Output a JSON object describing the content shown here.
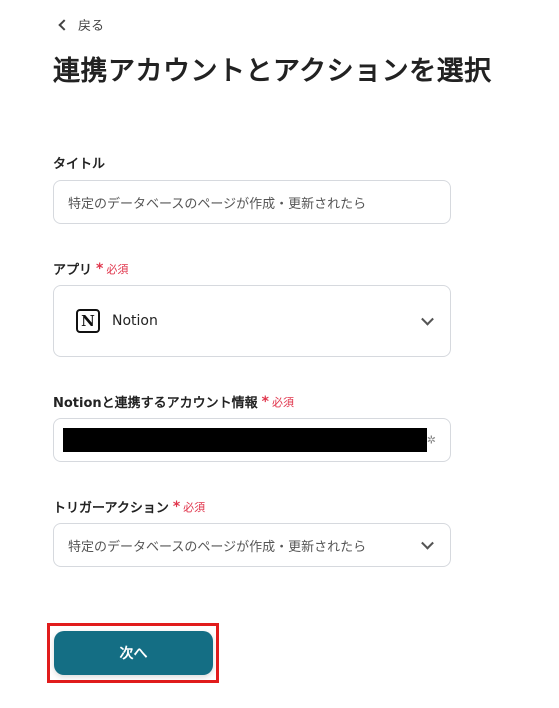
{
  "header": {
    "back_label": "戻る",
    "title": "連携アカウントとアクションを選択"
  },
  "form": {
    "title_field": {
      "label": "タイトル",
      "value": "特定のデータベースのページが作成・更新されたら"
    },
    "app_field": {
      "label": "アプリ",
      "required_label": "必須",
      "value": "Notion",
      "icon": "notion-icon"
    },
    "account_field": {
      "label": "Notionと連携するアカウント情報",
      "required_label": "必須"
    },
    "trigger_field": {
      "label": "トリガーアクション",
      "required_label": "必須",
      "value": "特定のデータベースのページが作成・更新されたら"
    }
  },
  "footer": {
    "next_label": "次へ"
  },
  "colors": {
    "accent": "#146e84",
    "required": "#e0344b",
    "highlight_border": "#e11c1c"
  }
}
